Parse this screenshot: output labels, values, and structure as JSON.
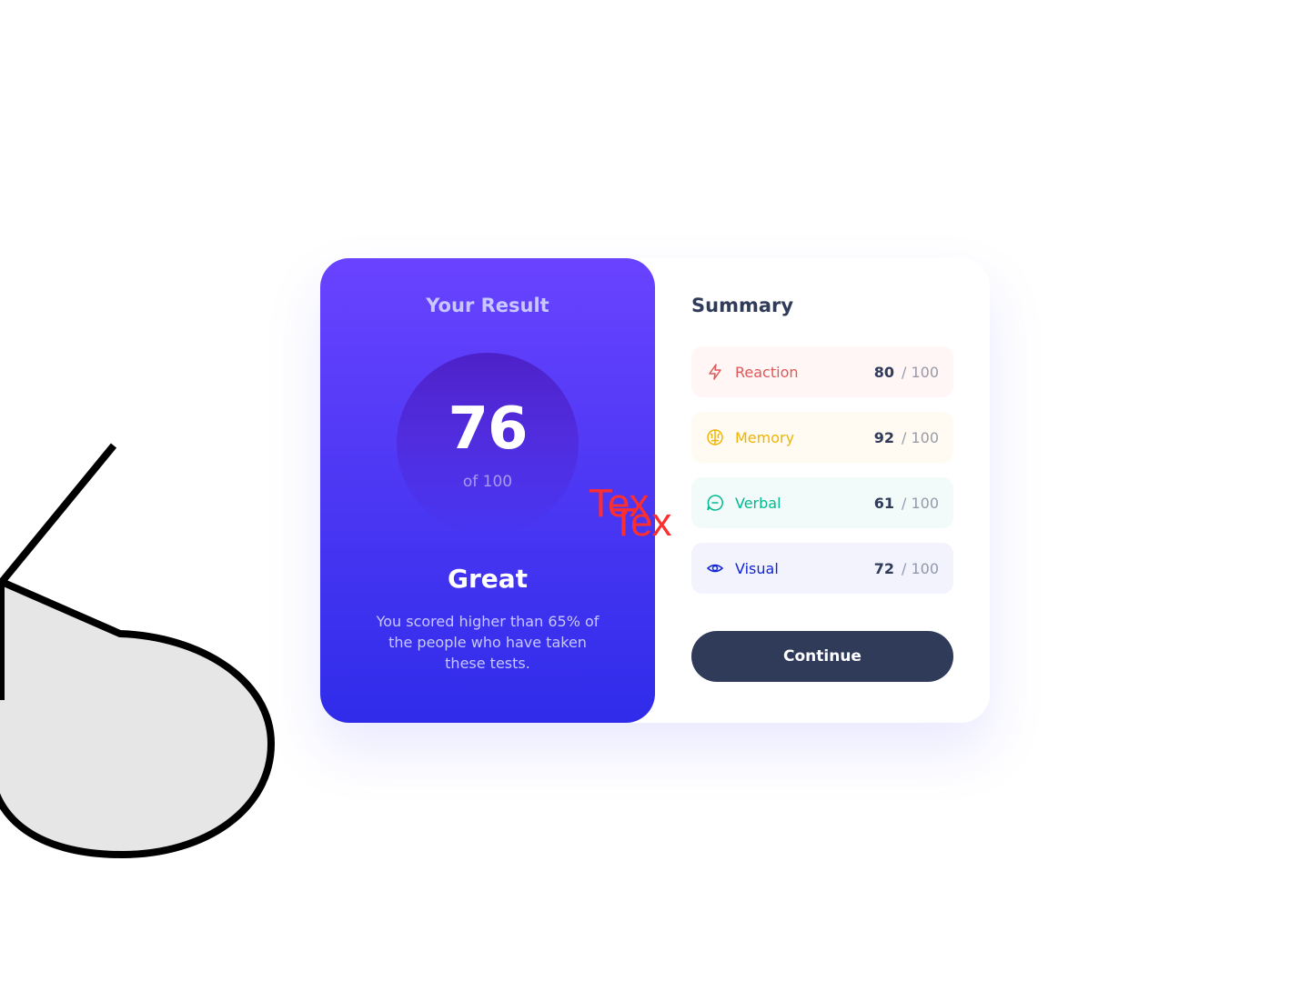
{
  "result": {
    "title": "Your Result",
    "score": "76",
    "of_label": "of 100",
    "rating": "Great",
    "description": "You scored higher than 65% of the people who have taken these tests."
  },
  "summary": {
    "title": "Summary",
    "items": [
      {
        "label": "Reaction",
        "score": "80",
        "max": "/ 100",
        "icon": "lightning-icon",
        "color": "#e05757",
        "bg": "#fff6f5"
      },
      {
        "label": "Memory",
        "score": "92",
        "max": "/ 100",
        "icon": "brain-icon",
        "color": "#f0b400",
        "bg": "#fffbf2"
      },
      {
        "label": "Verbal",
        "score": "61",
        "max": "/ 100",
        "icon": "chat-bubble-icon",
        "color": "#00bb8f",
        "bg": "#f2fbfa"
      },
      {
        "label": "Visual",
        "score": "72",
        "max": "/ 100",
        "icon": "eye-icon",
        "color": "#1125d6",
        "bg": "#f3f3fd"
      }
    ],
    "continue_label": "Continue"
  },
  "overlay": {
    "text_1": "Tex",
    "text_2": "Tex"
  },
  "colors": {
    "gradient_top": "#6943ff",
    "gradient_bottom": "#2f2ce9",
    "button": "#303b5a",
    "overlay_text": "#ff2e2e"
  }
}
